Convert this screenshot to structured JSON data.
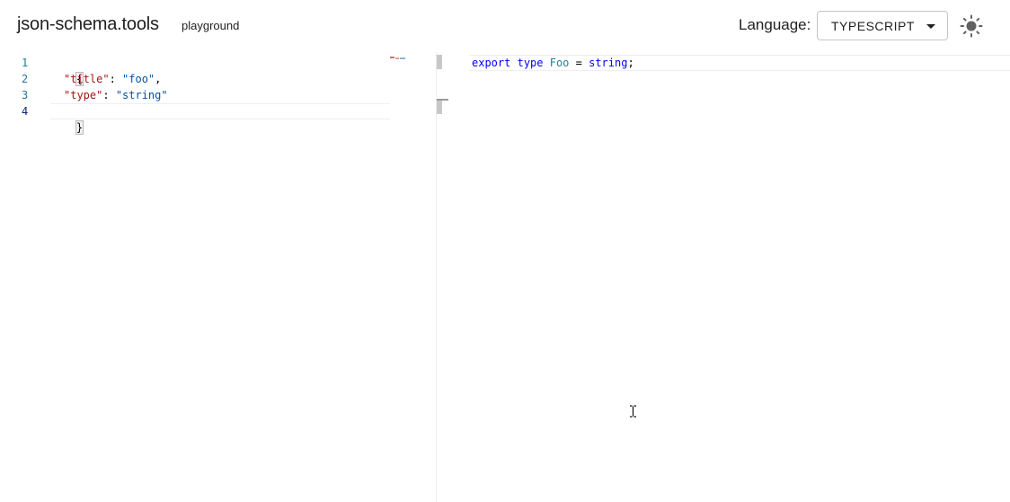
{
  "header": {
    "brand": "json-schema.tools",
    "subtitle": "playground",
    "language_label": "Language:",
    "language_value": "TYPESCRIPT",
    "theme_icon": "sun-icon"
  },
  "schema_editor": {
    "line_numbers": [
      "1",
      "2",
      "3",
      "4"
    ],
    "lines": [
      {
        "open": "{"
      },
      {
        "key": "\"title\"",
        "sep": ": ",
        "value": "\"foo\"",
        "end": ","
      },
      {
        "key": "\"type\"",
        "sep": ": ",
        "value": "\"string\"",
        "end": ""
      },
      {
        "close": "}"
      }
    ]
  },
  "output_editor": {
    "kw_export": "export",
    "kw_type": "type",
    "type_name": "Foo",
    "eq": " = ",
    "value": "string",
    "end": ";"
  },
  "colors": {
    "key": "#a31515",
    "string": "#0451a5",
    "keyword": "#0000ff",
    "type": "#267f99",
    "line_number": "#237893"
  }
}
